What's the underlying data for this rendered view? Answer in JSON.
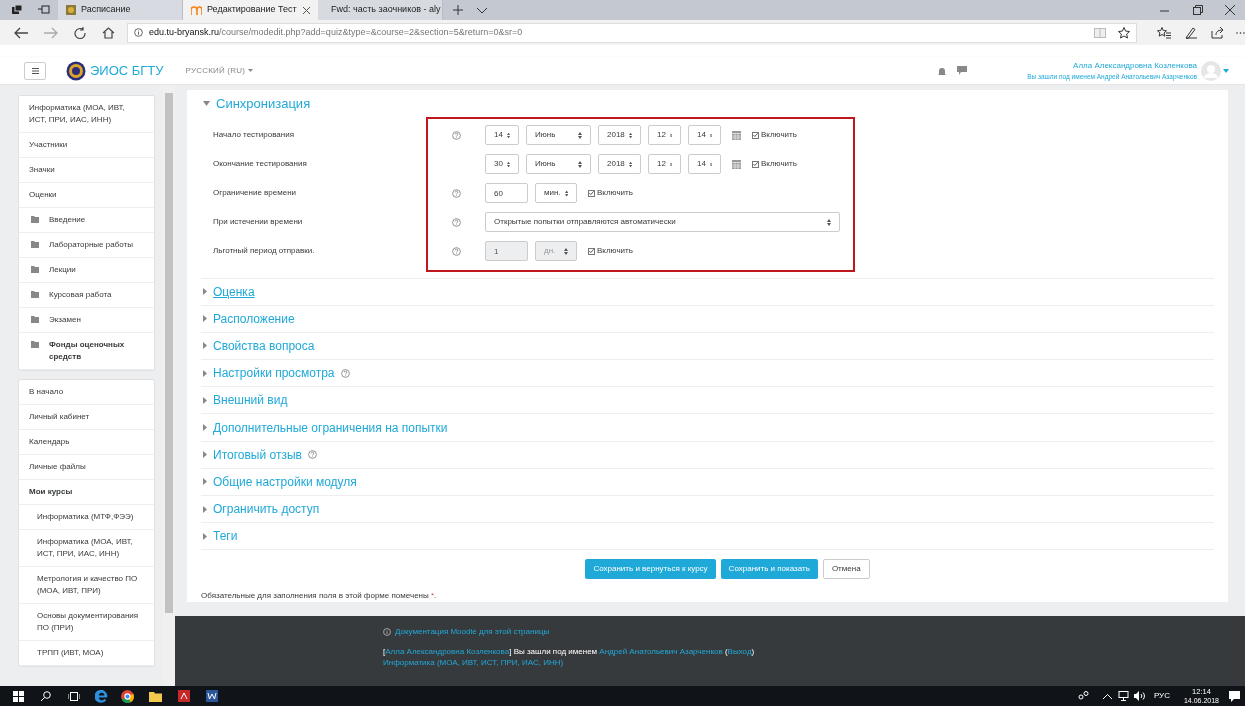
{
  "browser": {
    "tabs": [
      {
        "title": "Расписание",
        "selected": false
      },
      {
        "title": "Редактирование Тест",
        "selected": true
      },
      {
        "title": "Fwd: часть заочников - aly",
        "selected": false
      }
    ],
    "url": {
      "domain": "edu.tu-bryansk.ru",
      "path": "/course/modedit.php?add=quiz&type=&course=2&section=5&return=0&sr=0"
    }
  },
  "header": {
    "site_name": "ЭИОС БГТУ",
    "language": "РУССКИЙ (RU)",
    "user_name": "Алла Александровна Козленкова",
    "logged_in_as": "Вы зашли под именем Андрей Анатольевич Азарченков"
  },
  "sidebar": {
    "course_nav": [
      {
        "label": "Информатика (МОА, ИВТ, ИСТ, ПРИ, ИАС, ИНН)",
        "kind": "link",
        "bold": false
      },
      {
        "label": "Участники",
        "kind": "link",
        "bold": false
      },
      {
        "label": "Значки",
        "kind": "link",
        "bold": false
      },
      {
        "label": "Оценки",
        "kind": "link",
        "bold": false
      },
      {
        "label": "Введение",
        "kind": "folder",
        "bold": false
      },
      {
        "label": "Лабораторные работы",
        "kind": "folder",
        "bold": false
      },
      {
        "label": "Лекции",
        "kind": "folder",
        "bold": false
      },
      {
        "label": "Курсовая работа",
        "kind": "folder",
        "bold": false
      },
      {
        "label": "Экзамен",
        "kind": "folder",
        "bold": false
      },
      {
        "label": "Фонды оценочных средств",
        "kind": "folder",
        "bold": true
      }
    ],
    "site_nav": [
      {
        "label": "В начало",
        "bold": false
      },
      {
        "label": "Личный кабинет",
        "bold": false
      },
      {
        "label": "Календарь",
        "bold": false
      },
      {
        "label": "Личные файлы",
        "bold": false
      },
      {
        "label": "Мои курсы",
        "bold": true,
        "children": [
          {
            "label": "Информатика (МТФ,ФЭЭ)"
          },
          {
            "label": "Информатика (МОА, ИВТ, ИСТ, ПРИ, ИАС, ИНН)"
          },
          {
            "label": "Метрология и качество ПО (МОА, ИВТ, ПРИ)"
          },
          {
            "label": "Основы документирования ПО (ПРИ)"
          },
          {
            "label": "ТРПП (ИВТ, МОА)"
          }
        ]
      }
    ]
  },
  "form": {
    "section": {
      "title": "Синхронизация",
      "expanded": true
    },
    "fields": [
      {
        "kind": "datetime",
        "label": "Начало тестирования",
        "help": true,
        "day": "14",
        "month": "Июнь",
        "year": "2018",
        "hour": "12",
        "minute": "14",
        "enable_label": "Включить",
        "checked": true
      },
      {
        "kind": "datetime",
        "label": "Окончание тестирования",
        "help": false,
        "day": "30",
        "month": "Июнь",
        "year": "2018",
        "hour": "12",
        "minute": "14",
        "enable_label": "Включить",
        "checked": true
      },
      {
        "kind": "duration",
        "label": "Ограничение времени",
        "help": true,
        "value": "60",
        "unit": "мин.",
        "enable_label": "Включить",
        "checked": true,
        "disabled": false
      },
      {
        "kind": "select",
        "label": "При истечении времени",
        "help": true,
        "value": "Открытые попытки отправляются автоматически"
      },
      {
        "kind": "duration",
        "label": "Льготный период отправки.",
        "help": true,
        "value": "1",
        "unit": "дн.",
        "enable_label": "Включить",
        "checked": true,
        "disabled": true
      }
    ],
    "collapsed_sections": [
      {
        "title": "Оценка",
        "help": false,
        "focused": true,
        "expanded": false
      },
      {
        "title": "Расположение",
        "help": false,
        "focused": false,
        "expanded": false
      },
      {
        "title": "Свойства вопроса",
        "help": false,
        "focused": false,
        "expanded": false
      },
      {
        "title": "Настройки просмотра",
        "help": true,
        "focused": false,
        "expanded": false
      },
      {
        "title": "Внешний вид",
        "help": false,
        "focused": false,
        "expanded": false
      },
      {
        "title": "Дополнительные ограничения на попытки",
        "help": false,
        "focused": false,
        "expanded": false
      },
      {
        "title": "Итоговый отзыв",
        "help": true,
        "focused": false,
        "expanded": false
      },
      {
        "title": "Общие настройки модуля",
        "help": false,
        "focused": false,
        "expanded": false
      },
      {
        "title": "Ограничить доступ",
        "help": false,
        "focused": false,
        "expanded": false
      },
      {
        "title": "Теги",
        "help": false,
        "focused": false,
        "expanded": false
      }
    ],
    "buttons": [
      {
        "label": "Сохранить и вернуться к курсу",
        "kind": "primary"
      },
      {
        "label": "Сохранить и показать",
        "kind": "primary"
      },
      {
        "label": "Отмена",
        "kind": "secondary"
      }
    ],
    "required_note": {
      "text": "Обязательные для заполнения поля в этой форме помечены",
      "marker": "*",
      "end": "."
    }
  },
  "footer": {
    "doc_link": "Документация Moodle для этой страницы",
    "login_line": [
      {
        "text": "[",
        "link": false
      },
      {
        "text": "Алла Александровна Козленкова",
        "link": true
      },
      {
        "text": "] Вы зашли под именем",
        "link": false
      },
      {
        "text": "Андрей Анатольевич Азарченков",
        "link": true
      },
      {
        "text": "(",
        "link": false
      },
      {
        "text": "Выход",
        "link": true
      },
      {
        "text": ")",
        "link": false
      }
    ],
    "course_link": "Информатика (МОА, ИВТ, ИСТ, ПРИ, ИАС, ИНН)"
  },
  "taskbar": {
    "language": "РУС",
    "time": "12:14",
    "date": "14.06.2018"
  }
}
